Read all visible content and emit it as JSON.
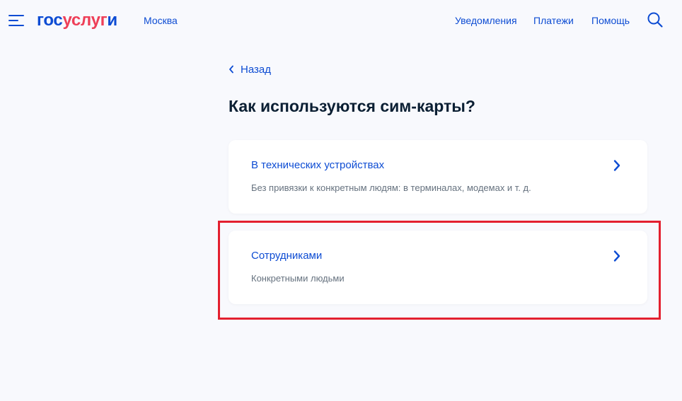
{
  "header": {
    "logo": {
      "part1": "гос",
      "part2": "услуг",
      "part3": "и"
    },
    "city": "Москва",
    "nav": {
      "notifications": "Уведомления",
      "payments": "Платежи",
      "help": "Помощь"
    },
    "icons": {
      "menu": "burger-menu-icon",
      "search": "search-icon"
    }
  },
  "back": {
    "label": "Назад",
    "icon": "chevron-left-icon"
  },
  "page_title": "Как используются сим-карты?",
  "options": [
    {
      "title": "В технических устройствах",
      "description": "Без привязки к конкретным людям: в терминалах, модемах и т. д.",
      "icon": "chevron-right-icon"
    },
    {
      "title": "Сотрудниками",
      "description": "Конкретными людьми",
      "icon": "chevron-right-icon"
    }
  ],
  "colors": {
    "brand_blue": "#0d4cd3",
    "brand_red": "#ee3f58",
    "text_dark": "#0b1f33",
    "text_muted": "#66727f",
    "background": "#f8f9fd",
    "highlight": "#e3202f"
  }
}
